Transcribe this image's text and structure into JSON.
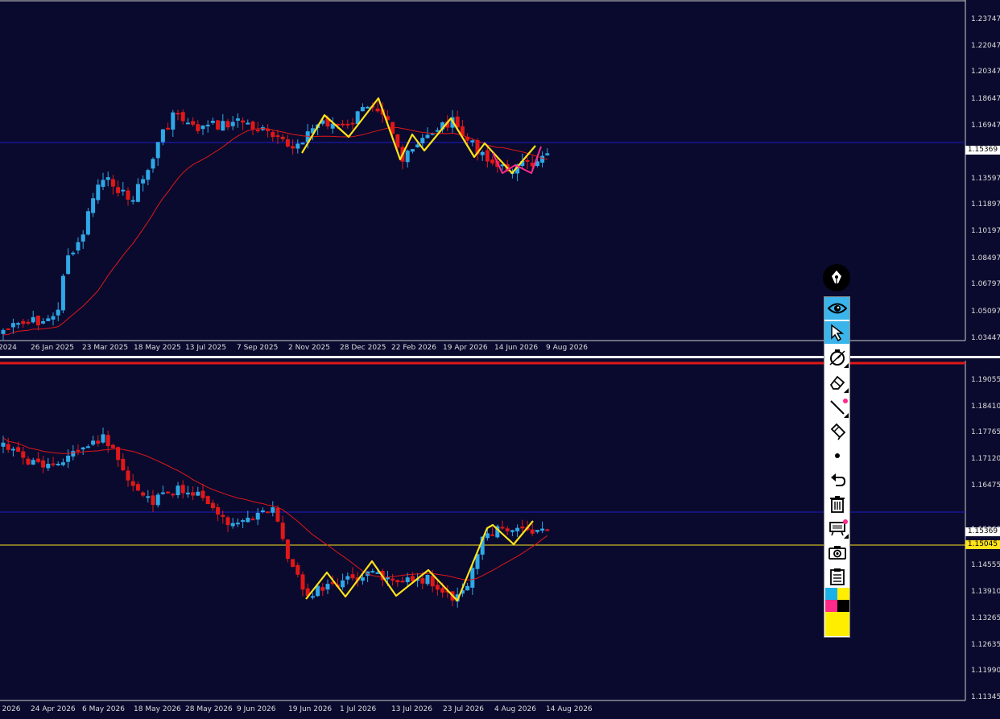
{
  "top_chart": {
    "price_labels": [
      "1.23747",
      "1.22047",
      "1.20347",
      "1.18647",
      "1.16947",
      "1.15369",
      "1.13597",
      "1.11897",
      "1.10197",
      "1.08497",
      "1.06797",
      "1.05097",
      "1.03447"
    ],
    "current_price": "1.15369",
    "date_labels": [
      "2024",
      "26 Jan 2025",
      "23 Mar 2025",
      "18 May 2025",
      "13 Jul 2025",
      "7 Sep 2025",
      "2 Nov 2025",
      "28 Dec 2025",
      "22 Feb 2026",
      "19 Apr 2026",
      "14 Jun 2026",
      "9 Aug 2026"
    ]
  },
  "bottom_chart": {
    "price_labels": [
      "1.19055",
      "1.18410",
      "1.17765",
      "1.17120",
      "1.16475",
      "1.15369",
      "1.15045",
      "1.14555",
      "1.13910",
      "1.13265",
      "1.12635",
      "1.11990",
      "1.11345"
    ],
    "current_price": "1.15369",
    "line_price": "1.15045",
    "date_labels": [
      "r 2026",
      "24 Apr 2026",
      "6 May 2026",
      "18 May 2026",
      "28 May 2026",
      "9 Jun 2026",
      "19 Jun 2026",
      "1 Jul 2026",
      "13 Jul 2026",
      "23 Jul 2026",
      "4 Aug 2026",
      "14 Aug 2026"
    ]
  },
  "colors": {
    "background": "#0a0a2e",
    "bull_candle": "#2fa8e6",
    "bear_candle": "#e01818",
    "ma_line": "#e01818",
    "zigzag": "#ffe21a",
    "current_line": "#1c1cc8",
    "level_line": "#ffe21a",
    "tag_current": "#ffffff",
    "tag_level": "#ffe21a",
    "toolbar_active": "#3ab4ea",
    "swatch_cyan": "#1ab0e8",
    "swatch_yellow": "#ffee00",
    "swatch_magenta": "#ff2a8a",
    "swatch_black": "#000000"
  },
  "toolbar": {
    "items": [
      "pen-icon",
      "eye-icon",
      "cursor-icon",
      "timer-icon",
      "eraser-icon",
      "line-icon",
      "highlighter-icon",
      "dot-icon",
      "undo-icon",
      "trash-icon",
      "screen-icon",
      "camera-icon",
      "clipboard-icon"
    ],
    "selected": [
      "eye-icon",
      "cursor-icon"
    ]
  }
}
